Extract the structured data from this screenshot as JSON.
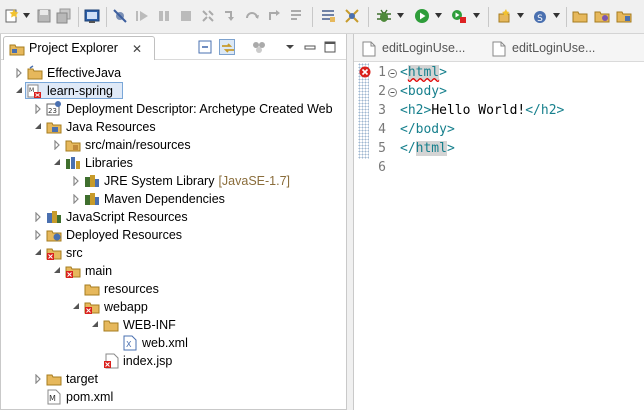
{
  "toolbar": {
    "icons": [
      "new-icon",
      "save-icon",
      "save-all-icon",
      "terminal-icon",
      "skip-breakpoints-icon",
      "resume-icon",
      "suspend-icon",
      "terminate-icon",
      "disconnect-icon",
      "step-into-icon",
      "step-over-icon",
      "step-return-icon",
      "drop-to-frame-icon",
      "use-step-filters-icon",
      "debug-icon",
      "run-icon",
      "external-tools-icon",
      "new-java-project-icon",
      "new-java-package-icon",
      "open-type-icon",
      "open-task-icon"
    ]
  },
  "project_explorer": {
    "title": "Project Explorer",
    "close_glyph": "✕",
    "tree": [
      {
        "label": "EffectiveJava",
        "level": 0,
        "expanded": false,
        "icon": "java-project-icon"
      },
      {
        "label": "learn-spring",
        "level": 0,
        "expanded": true,
        "selected": true,
        "icon": "maven-web-project-icon"
      },
      {
        "label": "Deployment Descriptor: Archetype Created Web",
        "level": 1,
        "expanded": false,
        "icon": "deployment-descriptor-icon"
      },
      {
        "label": "Java Resources",
        "level": 1,
        "expanded": true,
        "icon": "java-resources-icon"
      },
      {
        "label": "src/main/resources",
        "level": 2,
        "expanded": false,
        "icon": "source-folder-icon"
      },
      {
        "label": "Libraries",
        "level": 2,
        "expanded": true,
        "icon": "libraries-icon"
      },
      {
        "label": "JRE System Library",
        "decoration": "[JavaSE-1.7]",
        "level": 3,
        "expanded": false,
        "icon": "library-icon"
      },
      {
        "label": "Maven Dependencies",
        "level": 3,
        "expanded": false,
        "icon": "library-icon"
      },
      {
        "label": "JavaScript Resources",
        "level": 1,
        "expanded": false,
        "icon": "javascript-resources-icon"
      },
      {
        "label": "Deployed Resources",
        "level": 1,
        "expanded": false,
        "icon": "deployed-resources-icon"
      },
      {
        "label": "src",
        "level": 1,
        "expanded": true,
        "icon": "folder-error-icon"
      },
      {
        "label": "main",
        "level": 2,
        "expanded": true,
        "icon": "folder-error-icon"
      },
      {
        "label": "resources",
        "level": 3,
        "expanded": null,
        "icon": "folder-icon"
      },
      {
        "label": "webapp",
        "level": 3,
        "expanded": true,
        "icon": "folder-error-icon"
      },
      {
        "label": "WEB-INF",
        "level": 4,
        "expanded": true,
        "icon": "folder-icon"
      },
      {
        "label": "web.xml",
        "level": 5,
        "expanded": null,
        "icon": "xml-file-icon"
      },
      {
        "label": "index.jsp",
        "level": 4,
        "expanded": null,
        "icon": "jsp-file-error-icon"
      },
      {
        "label": "target",
        "level": 1,
        "expanded": false,
        "icon": "folder-icon"
      },
      {
        "label": "pom.xml",
        "level": 1,
        "expanded": null,
        "icon": "maven-pom-icon"
      }
    ]
  },
  "editor": {
    "tabs": [
      {
        "label": "editLoginUse..."
      },
      {
        "label": "editLoginUse..."
      }
    ],
    "lines": [
      {
        "num": "1",
        "fold": true,
        "error": true
      },
      {
        "num": "2",
        "fold": true
      },
      {
        "num": "3"
      },
      {
        "num": "4"
      },
      {
        "num": "5"
      },
      {
        "num": "6"
      }
    ],
    "code": {
      "l1_open": "<",
      "l1_tag": "html",
      "l1_close": ">",
      "l2": "<body>",
      "l3_open": "<h2>",
      "l3_text": "Hello World!",
      "l3_close": "</h2>",
      "l4": "</body>",
      "l5_open": "</",
      "l5_tag": "html",
      "l5_close": ">"
    }
  },
  "colors": {
    "tag": "#17808d",
    "selection_bg": "#dfe9f7",
    "selection_border": "#7aa7d8",
    "decoration": "#8a6d3b",
    "error": "#e00000"
  }
}
